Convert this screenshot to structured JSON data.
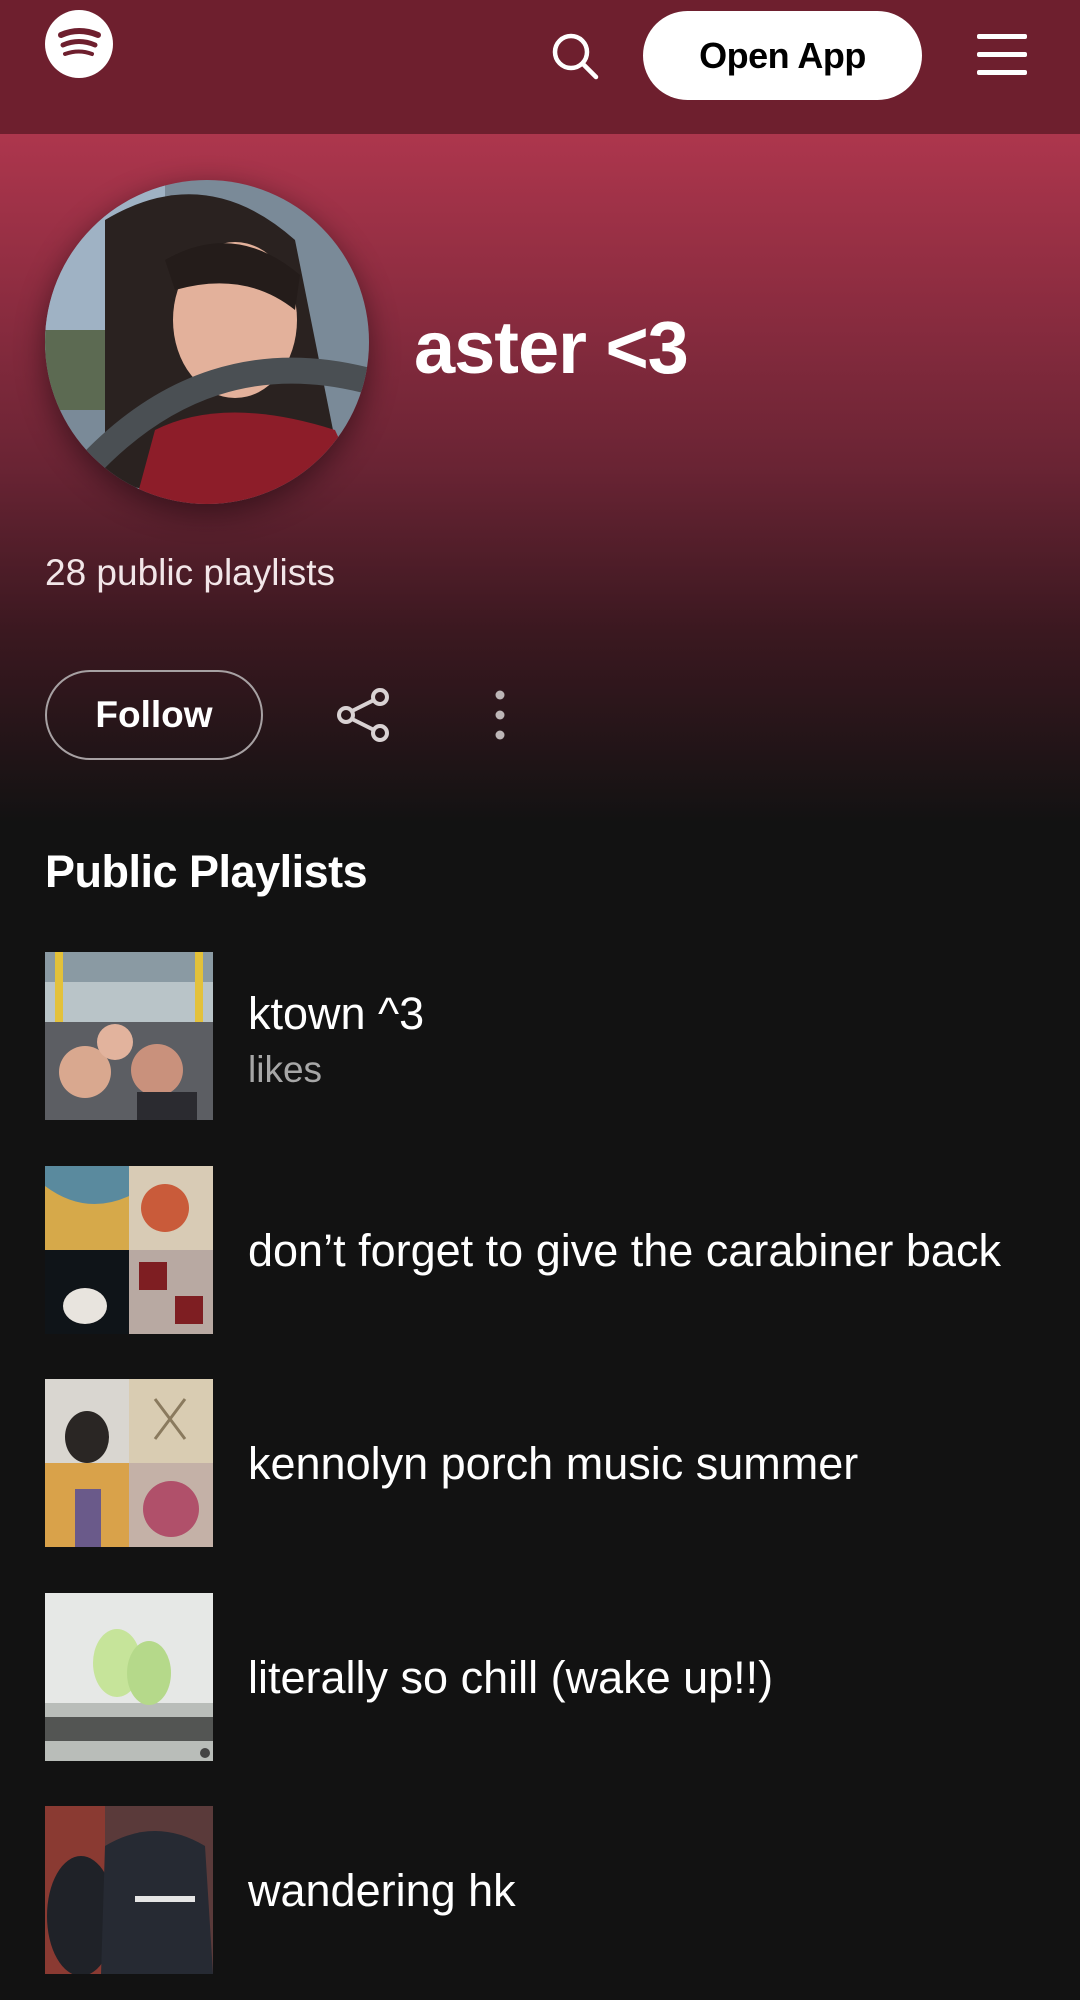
{
  "topbar": {
    "open_app_label": "Open App"
  },
  "icons": {
    "logo": "spotify-logo",
    "search": "search-icon",
    "menu": "hamburger-menu-icon",
    "share": "share-icon",
    "more": "more-vertical-icon"
  },
  "profile": {
    "name": "aster <3",
    "playlist_count": "28 public playlists",
    "follow_label": "Follow"
  },
  "section": {
    "title": "Public Playlists"
  },
  "playlists": [
    {
      "title": "ktown ^3",
      "subtitle": "likes"
    },
    {
      "title": "don’t forget to give the carabiner back",
      "subtitle": ""
    },
    {
      "title": "kennolyn porch music summer",
      "subtitle": ""
    },
    {
      "title": "literally so chill (wake up!!)",
      "subtitle": ""
    },
    {
      "title": "wandering hk",
      "subtitle": ""
    }
  ],
  "colors": {
    "topbar": "#6e1f2e",
    "hero_top": "#ad364d",
    "background": "#121212",
    "button_white": "#ffffff"
  }
}
